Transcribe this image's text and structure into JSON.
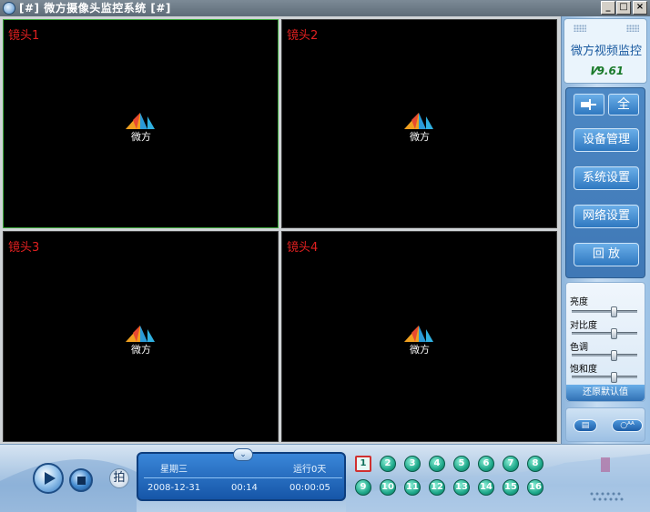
{
  "window": {
    "title": "[#] 微方摄像头监控系统 [#]",
    "min_label": "_",
    "max_label": "□",
    "close_label": "×"
  },
  "cameras": [
    {
      "label": "镜头1",
      "logo_text": "微方"
    },
    {
      "label": "镜头2",
      "logo_text": "微方"
    },
    {
      "label": "镜头3",
      "logo_text": "微方"
    },
    {
      "label": "镜头4",
      "logo_text": "微方"
    }
  ],
  "panel": {
    "brand": "微方视频监控",
    "version": "9.61",
    "pin_icon": "pin-icon",
    "fullscreen_label": "全",
    "menu": [
      "设备管理",
      "系统设置",
      "网络设置",
      "回 放"
    ],
    "adjust": [
      {
        "label": "亮度",
        "level": 0.65
      },
      {
        "label": "对比度",
        "level": 0.65
      },
      {
        "label": "色调",
        "level": 0.65
      },
      {
        "label": "饱和度",
        "level": 0.65
      }
    ],
    "reset_label": "还原默认值",
    "bottom_buttons": [
      "▤",
      "○ᴬᴬ"
    ]
  },
  "playback": {
    "snapshot_label": "拍",
    "weekday": "星期三",
    "running": "运行0天",
    "date": "2008-12-31",
    "time": "00:14",
    "uptime": "00:00:05",
    "expand_icon": "chevron-down-icon"
  },
  "channels": [
    "1",
    "2",
    "3",
    "4",
    "5",
    "6",
    "7",
    "8",
    "9",
    "10",
    "11",
    "12",
    "13",
    "14",
    "15",
    "16"
  ],
  "selected_channel": "1",
  "colors": {
    "camera_label": "#e02020",
    "active_border": "#3ca83c",
    "accent_blue": "#2f78c0",
    "channel_teal": "#1ea88a"
  }
}
